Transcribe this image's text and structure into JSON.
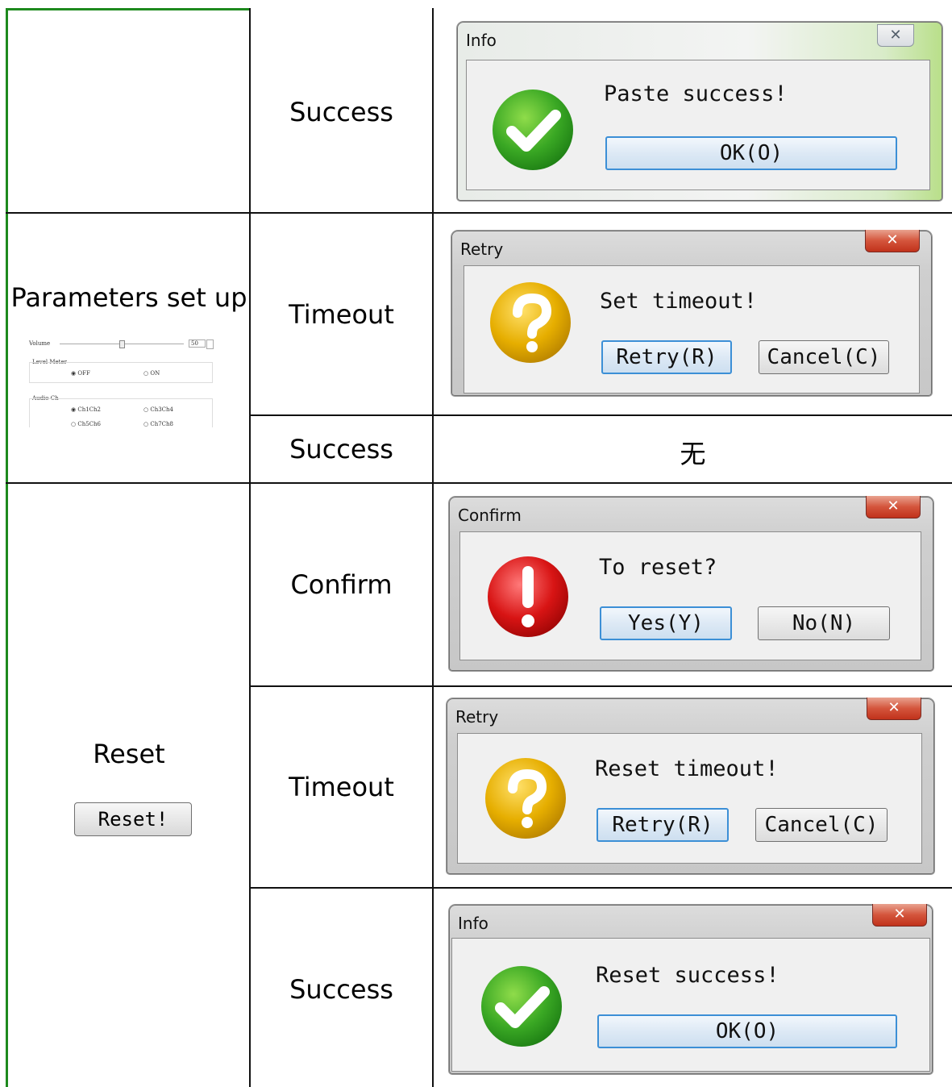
{
  "table": {
    "rows": [
      {
        "function": "",
        "result": "Success",
        "dialog": {
          "title": "Info",
          "message": "Paste success!",
          "buttons": [
            "OK(O)"
          ],
          "icon": "success-check-icon"
        }
      },
      {
        "function": "Parameters set up",
        "result": "Timeout",
        "dialog": {
          "title": "Retry",
          "message": "Set timeout!",
          "buttons": [
            "Retry(R)",
            "Cancel(C)"
          ],
          "icon": "question-icon"
        }
      },
      {
        "function": "",
        "result": "Success",
        "none_text": "无"
      },
      {
        "function": "Reset",
        "function_button": "Reset!",
        "result": "Confirm",
        "dialog": {
          "title": "Confirm",
          "message": "To reset?",
          "buttons": [
            "Yes(Y)",
            "No(N)"
          ],
          "icon": "error-exclamation-icon"
        }
      },
      {
        "result": "Timeout",
        "dialog": {
          "title": "Retry",
          "message": "Reset timeout!",
          "buttons": [
            "Retry(R)",
            "Cancel(C)"
          ],
          "icon": "question-icon"
        }
      },
      {
        "result": "Success",
        "dialog": {
          "title": "Info",
          "message": "Reset success!",
          "buttons": [
            "OK(O)"
          ],
          "icon": "success-check-icon"
        }
      }
    ]
  },
  "mini_panel": {
    "volume_label": "Volume",
    "volume_value": "50",
    "level_meter_label": "Level Meter",
    "off_label": "OFF",
    "on_label": "ON",
    "audio_ch_label": "Audio Ch",
    "ch12": "Ch1Ch2",
    "ch34": "Ch3Ch4",
    "ch56": "Ch5Ch6",
    "ch78": "Ch7Ch8"
  },
  "colors": {
    "outer_border": "#1e8a1e",
    "dialog_button_border": "#3c8fd6",
    "success_green": "#2fa12f",
    "question_yellow": "#e8b000",
    "error_red": "#d41010"
  }
}
